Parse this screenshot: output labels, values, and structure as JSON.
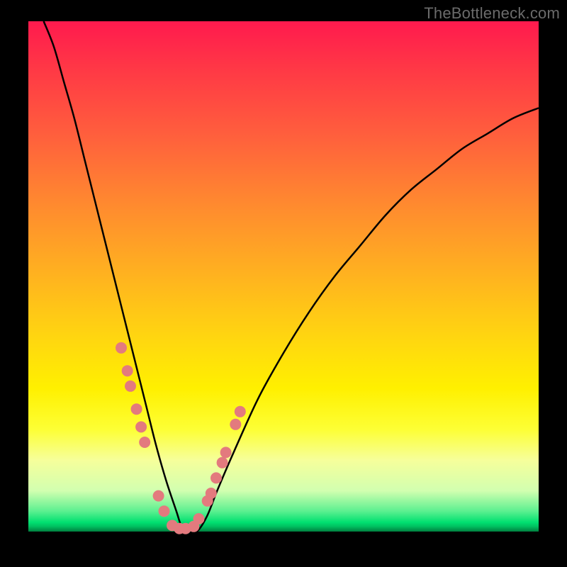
{
  "attribution": "TheBottleneck.com",
  "chart_data": {
    "type": "line",
    "title": "",
    "xlabel": "",
    "ylabel": "",
    "xlim": [
      0,
      100
    ],
    "ylim": [
      0,
      100
    ],
    "grid": false,
    "series": [
      {
        "name": "bottleneck-curve",
        "x": [
          3,
          5,
          7,
          9,
          11,
          13,
          15,
          17,
          19,
          21,
          23,
          25,
          27,
          29,
          30,
          31,
          33,
          35,
          37,
          40,
          45,
          50,
          55,
          60,
          65,
          70,
          75,
          80,
          85,
          90,
          95,
          100
        ],
        "y": [
          100,
          95,
          88,
          81,
          73,
          65,
          57,
          49,
          41,
          33,
          25,
          17,
          10,
          4,
          1,
          0,
          0,
          3,
          8,
          15,
          26,
          35,
          43,
          50,
          56,
          62,
          67,
          71,
          75,
          78,
          81,
          83
        ]
      }
    ],
    "markers": {
      "name": "highlight-points",
      "x": [
        18.2,
        19.4,
        20.0,
        21.2,
        22.1,
        22.8,
        25.5,
        26.6,
        28.2,
        29.6,
        30.8,
        32.4,
        33.4,
        35.1,
        35.8,
        36.8,
        38.0,
        38.7,
        40.6,
        41.5
      ],
      "y": [
        36.0,
        31.5,
        28.5,
        24.0,
        20.5,
        17.5,
        7.0,
        4.0,
        1.2,
        0.6,
        0.6,
        1.0,
        2.5,
        6.0,
        7.5,
        10.5,
        13.5,
        15.5,
        21.0,
        23.5
      ]
    },
    "background_gradient": {
      "stops": [
        {
          "pos": 0.0,
          "color": "#ff1a4e"
        },
        {
          "pos": 0.5,
          "color": "#ffb31f"
        },
        {
          "pos": 0.8,
          "color": "#fdff35"
        },
        {
          "pos": 0.96,
          "color": "#5cf090"
        },
        {
          "pos": 1.0,
          "color": "#008040"
        }
      ]
    }
  }
}
